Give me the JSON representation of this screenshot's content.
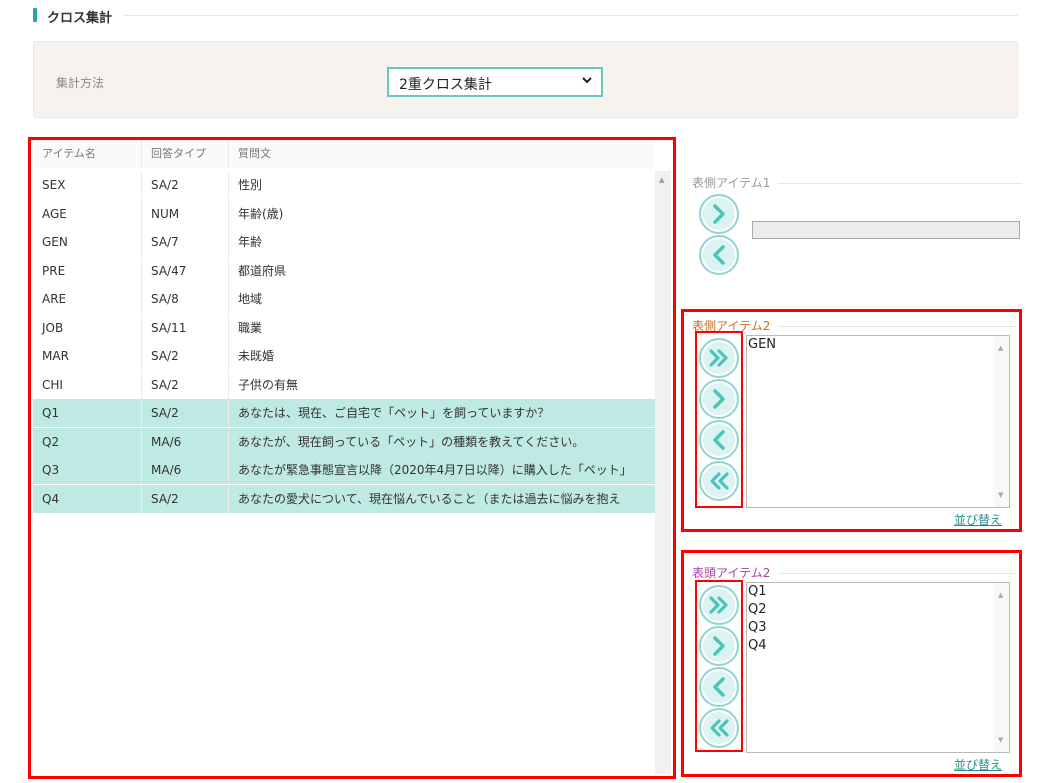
{
  "section": {
    "title": "クロス集計"
  },
  "method": {
    "label": "集計方法",
    "selected": "2重クロス集計"
  },
  "table": {
    "columns": [
      "アイテム名",
      "回答タイプ",
      "質問文"
    ],
    "rows": [
      {
        "name": "SEX",
        "type": "SA/2",
        "question": "性別",
        "selected": false
      },
      {
        "name": "AGE",
        "type": "NUM",
        "question": "年齢(歳)",
        "selected": false
      },
      {
        "name": "GEN",
        "type": "SA/7",
        "question": "年齢",
        "selected": false
      },
      {
        "name": "PRE",
        "type": "SA/47",
        "question": "都道府県",
        "selected": false
      },
      {
        "name": "ARE",
        "type": "SA/8",
        "question": "地域",
        "selected": false
      },
      {
        "name": "JOB",
        "type": "SA/11",
        "question": "職業",
        "selected": false
      },
      {
        "name": "MAR",
        "type": "SA/2",
        "question": "未既婚",
        "selected": false
      },
      {
        "name": "CHI",
        "type": "SA/2",
        "question": "子供の有無",
        "selected": false
      },
      {
        "name": "Q1",
        "type": "SA/2",
        "question": "あなたは、現在、ご自宅で「ペット」を飼っていますか？",
        "selected": true
      },
      {
        "name": "Q2",
        "type": "MA/6",
        "question": "あなたが、現在飼っている「ペット」の種類を教えてください。",
        "selected": true
      },
      {
        "name": "Q3",
        "type": "MA/6",
        "question": "あなたが緊急事態宣言以降（2020年4月7日以降）に購入した「ペット」",
        "selected": true
      },
      {
        "name": "Q4",
        "type": "SA/2",
        "question": "あなたの愛犬について、現在悩んでいること（または過去に悩みを抱え",
        "selected": true
      }
    ]
  },
  "side1": {
    "label": "表側アイテム1",
    "value": ""
  },
  "side2": {
    "label": "表側アイテム2",
    "items": [
      "GEN"
    ],
    "sort_label": "並び替え"
  },
  "head2": {
    "label": "表頭アイテム2",
    "items": [
      "Q1",
      "Q2",
      "Q3",
      "Q4"
    ],
    "sort_label": "並び替え"
  },
  "colors": {
    "accent": "#2aa59a",
    "selected_row": "#bfeae3",
    "highlight": "#ff0000",
    "side2_label": "#c9702a",
    "head2_label": "#a63ea8",
    "side1_label": "#999999"
  }
}
